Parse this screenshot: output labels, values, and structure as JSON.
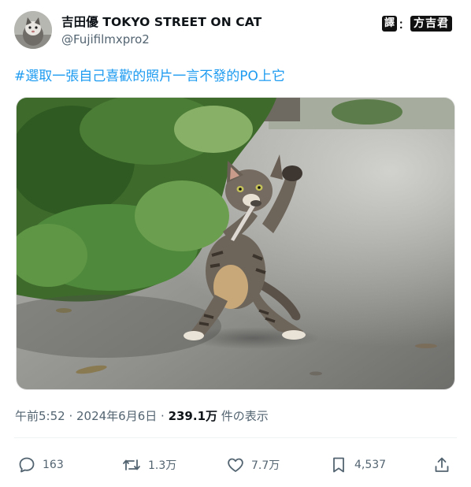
{
  "author": {
    "display_name": "吉田優 TOKYO STREET ON CAT",
    "handle": "@Fujifilmxpro2"
  },
  "translator_tag": {
    "label": "譯",
    "separator": "：",
    "name": "方吉君"
  },
  "tweet": {
    "text": "#選取一張自己喜歡的照片一言不發的PO上它"
  },
  "meta": {
    "time_date": "午前5:52 · 2024年6月6日 · ",
    "views_count": "239.1万",
    "views_label": " 件の表示"
  },
  "actions": {
    "replies": "163",
    "reposts": "1.3万",
    "likes": "7.7万",
    "bookmarks": "4,537"
  },
  "icons": {
    "reply": "reply-icon",
    "repost": "repost-icon",
    "like": "heart-icon",
    "bookmark": "bookmark-icon",
    "share": "share-icon"
  },
  "colors": {
    "link": "#1d9bf0",
    "secondary_text": "#536471",
    "primary_text": "#0f1419"
  }
}
